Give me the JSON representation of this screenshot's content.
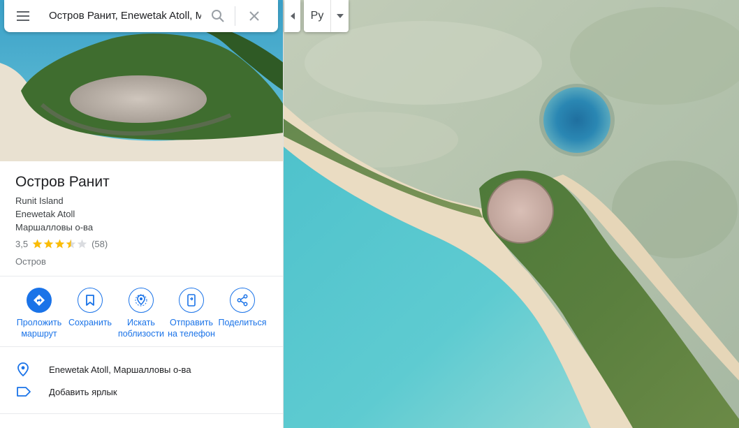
{
  "search": {
    "value": "Остров Ранит, Enewetak Atoll, М"
  },
  "lang_switch": {
    "label": "Ру"
  },
  "place": {
    "title": "Остров Ранит",
    "subtitle_lines": [
      "Runit Island",
      "Enewetak Atoll",
      "Маршалловы о-ва"
    ],
    "rating": "3,5",
    "rating_stars": 3.5,
    "review_count": "(58)",
    "type": "Остров"
  },
  "actions": [
    {
      "label_1": "Проложить",
      "label_2": "маршрут",
      "icon": "directions-icon"
    },
    {
      "label_1": "Сохранить",
      "label_2": "",
      "icon": "bookmark-icon"
    },
    {
      "label_1": "Искать",
      "label_2": "поблизости",
      "icon": "nearby-icon"
    },
    {
      "label_1": "Отправить",
      "label_2": "на телефон",
      "icon": "send-to-phone-icon"
    },
    {
      "label_1": "Поделиться",
      "label_2": "",
      "icon": "share-icon"
    }
  ],
  "details": {
    "address": "Enewetak Atoll, Маршалловы о-ва",
    "add_label": "Добавить ярлык"
  },
  "colors": {
    "accent": "#1a73e8",
    "star": "#fbbc04",
    "star_empty": "#dadce0"
  }
}
